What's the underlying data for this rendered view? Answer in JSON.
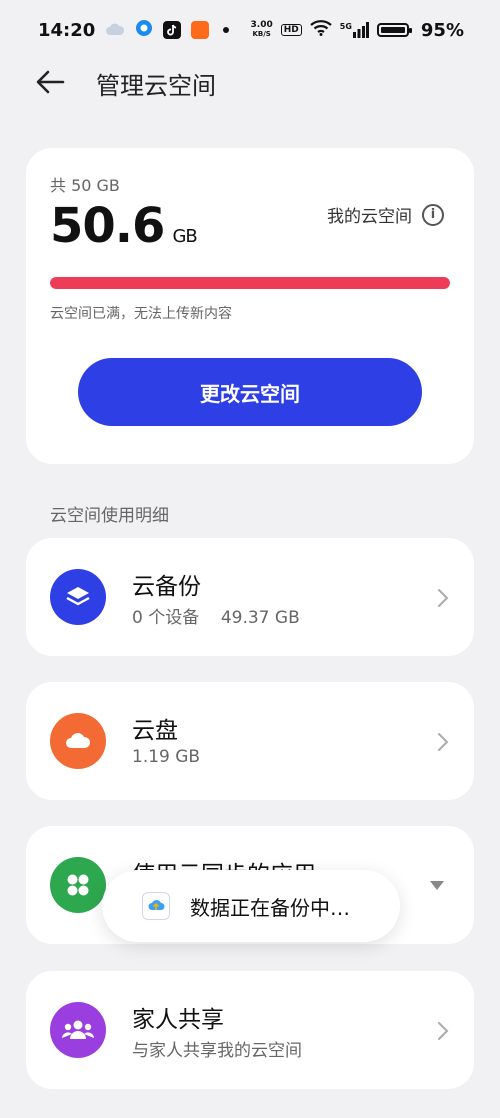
{
  "status_bar": {
    "time": "14:20",
    "net_speed_value": "3.00",
    "net_speed_unit": "KB/S",
    "hd": "HD",
    "signal": "5G",
    "battery": "95%"
  },
  "header": {
    "title": "管理云空间"
  },
  "storage": {
    "quota_label": "共 50 GB",
    "used_value": "50.6",
    "used_unit": "GB",
    "my_space_label": "我的云空间",
    "progress_fraction": 1.0,
    "full_message": "云空间已满，无法上传新内容",
    "change_button": "更改云空间"
  },
  "section_title": "云空间使用明细",
  "items": [
    {
      "title": "云备份",
      "subtitle": "0 个设备    49.37 GB",
      "icon": "layers-icon",
      "color": "#2f3fe6"
    },
    {
      "title": "云盘",
      "subtitle": "1.19 GB",
      "icon": "cloud-icon",
      "color": "#f46a35"
    },
    {
      "title": "使用云同步的应用",
      "subtitle": "",
      "icon": "grid-icon",
      "color": "#2ea84f"
    },
    {
      "title": "家人共享",
      "subtitle": "与家人共享我的云空间",
      "icon": "family-icon",
      "color": "#9a3ee0"
    }
  ],
  "toast": {
    "text": "数据正在备份中…"
  },
  "colors": {
    "accent": "#2f3fe6",
    "danger": "#ee3b57"
  }
}
